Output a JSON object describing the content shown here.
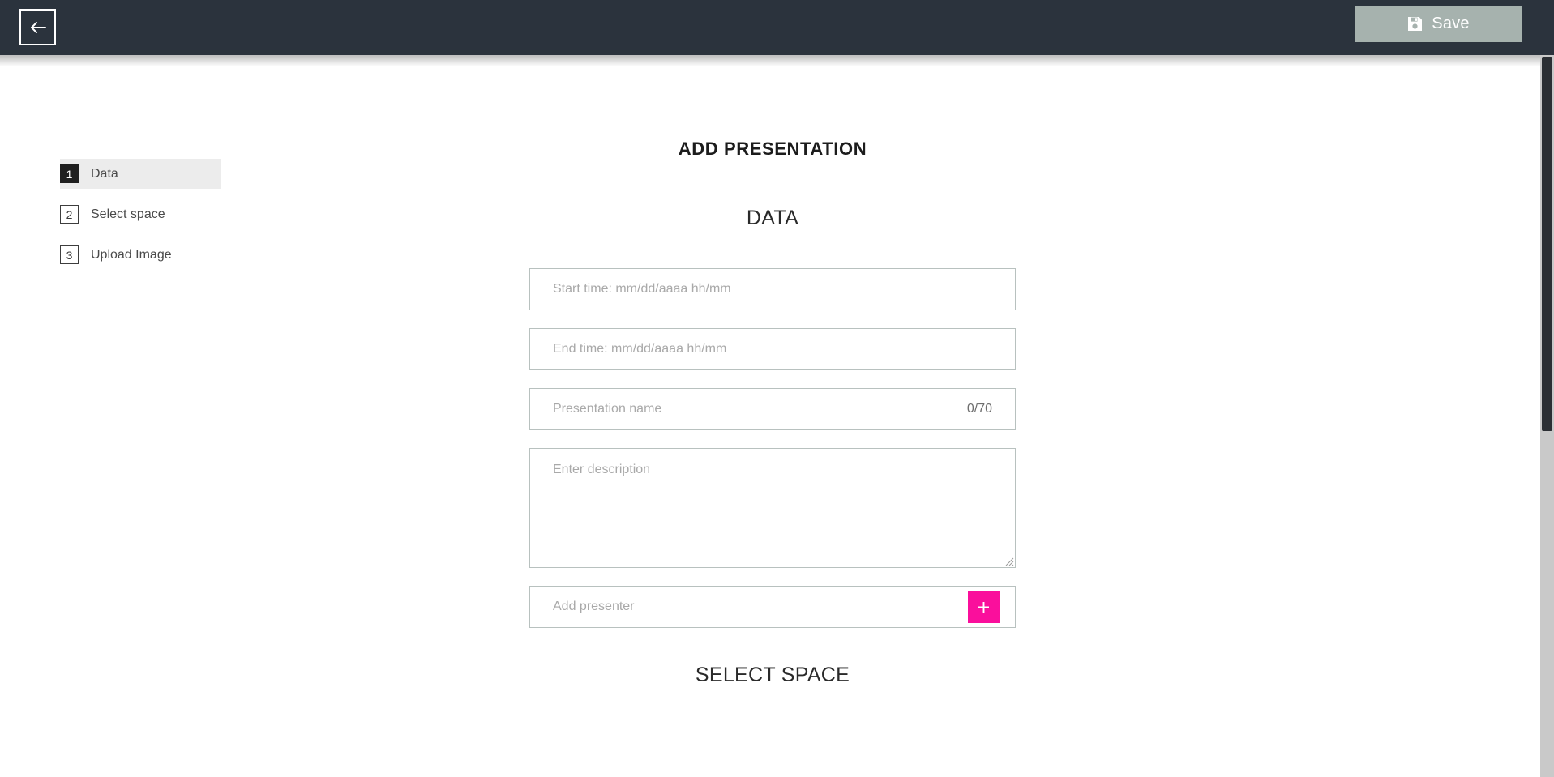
{
  "topbar": {
    "back_icon": "arrow-left-icon",
    "save_icon": "save-floppy-icon",
    "save_label": "Save",
    "background_color": "#2b333d",
    "save_button_color": "#a6b2ae"
  },
  "stepper": {
    "items": [
      {
        "number": "1",
        "label": "Data",
        "active": true
      },
      {
        "number": "2",
        "label": "Select space",
        "active": false
      },
      {
        "number": "3",
        "label": "Upload Image",
        "active": false
      }
    ],
    "active_background": "#ececec"
  },
  "main": {
    "page_title": "ADD PRESENTATION",
    "sections": {
      "data_heading": "DATA",
      "select_space_heading": "SELECT SPACE"
    },
    "fields": {
      "start_time": {
        "placeholder": "Start time: mm/dd/aaaa hh/mm",
        "value": ""
      },
      "end_time": {
        "placeholder": "End time: mm/dd/aaaa hh/mm",
        "value": ""
      },
      "presentation_name": {
        "placeholder": "Presentation name",
        "value": "",
        "counter": "0/70"
      },
      "description": {
        "placeholder": "Enter description",
        "value": ""
      },
      "presenter": {
        "placeholder": "Add presenter",
        "value": "",
        "add_icon": "plus-icon",
        "add_button_color": "#fa0f9c"
      }
    }
  },
  "scrollbar": {
    "track_color": "#c9c9c9",
    "thumb_color": "#2b2f34"
  }
}
